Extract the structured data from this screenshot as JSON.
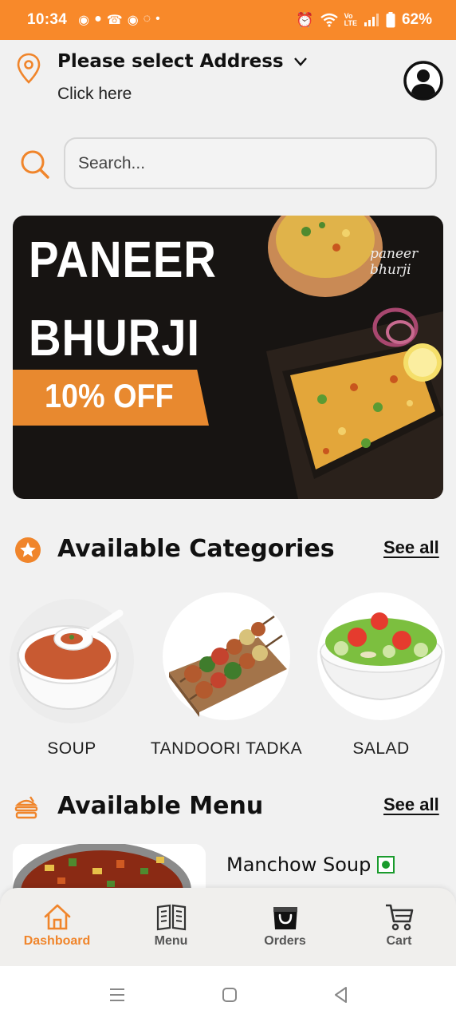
{
  "status_bar": {
    "time": "10:34",
    "battery": "62%",
    "notification_icons": [
      "whatsapp-icon",
      "chat-icon",
      "missed-call-icon",
      "viber-icon",
      "app-icon",
      "dot-icon"
    ],
    "system_icons": [
      "alarm-icon",
      "wifi-icon",
      "volte-icon",
      "signal-icon",
      "battery-icon"
    ]
  },
  "header": {
    "address_title": "Please select Address",
    "address_subtitle": "Click here"
  },
  "search": {
    "placeholder": "Search..."
  },
  "banner": {
    "line1": "PANEER",
    "line2": "BHURJI",
    "offer": "10% OFF",
    "brand": "paneer bhurji"
  },
  "categories": {
    "title": "Available Categories",
    "see_all": "See all",
    "items": [
      {
        "label": "SOUP",
        "icon": "soup-bowl-image"
      },
      {
        "label": "TANDOORI TADKA",
        "icon": "tandoori-skewer-image"
      },
      {
        "label": "SALAD",
        "icon": "salad-bowl-image"
      }
    ]
  },
  "menu": {
    "title": "Available Menu",
    "see_all": "See all",
    "items": [
      {
        "name": "Manchow Soup",
        "veg": true
      }
    ]
  },
  "bottom_nav": {
    "items": [
      {
        "label": "Dashboard",
        "icon": "home-icon",
        "active": true
      },
      {
        "label": "Menu",
        "icon": "book-icon",
        "active": false
      },
      {
        "label": "Orders",
        "icon": "bag-icon",
        "active": false
      },
      {
        "label": "Cart",
        "icon": "cart-icon",
        "active": false
      }
    ]
  },
  "colors": {
    "accent": "#f0852b",
    "status_bar": "#f8892a",
    "background": "#f1f1f1",
    "banner_bg": "#171412",
    "veg_green": "#1a9b2d"
  }
}
